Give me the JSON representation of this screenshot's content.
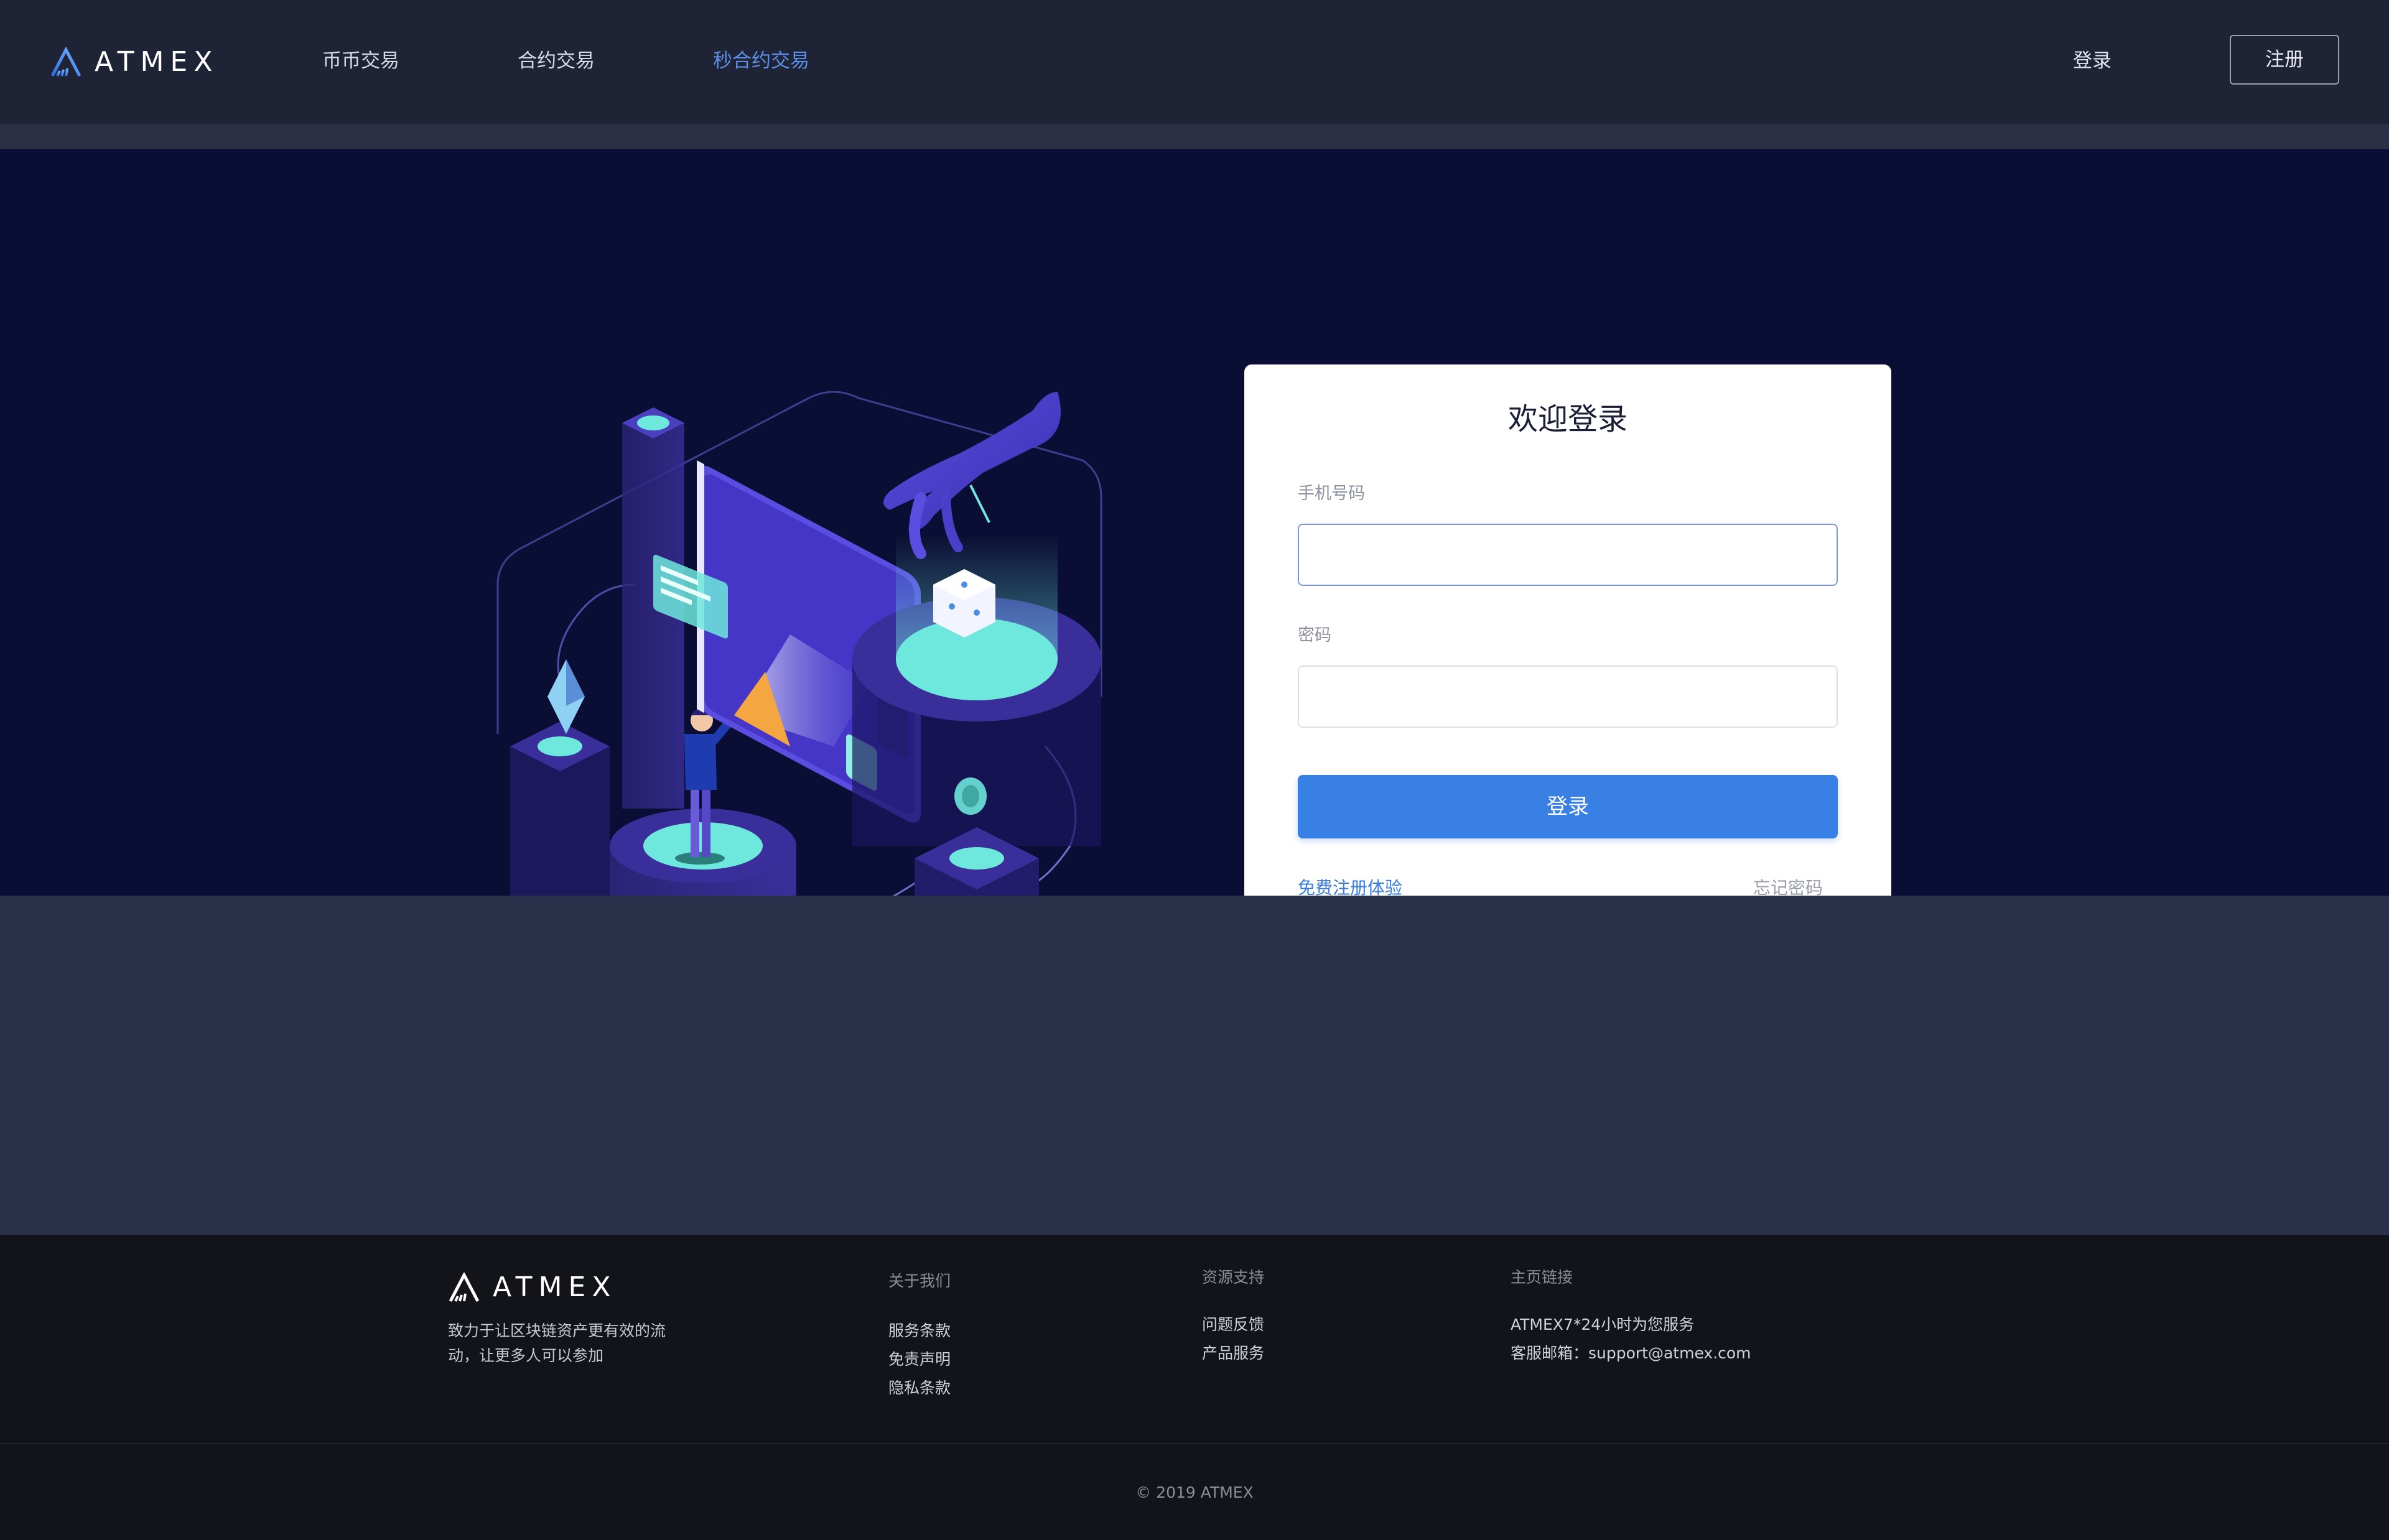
{
  "brand": {
    "name": "ATMEX",
    "accent": "#3880e4",
    "nav_active": "#5c8fe6"
  },
  "nav": {
    "items": [
      {
        "label": "币币交易"
      },
      {
        "label": "合约交易"
      },
      {
        "label": "秒合约交易",
        "active": true
      }
    ],
    "login_label": "登录",
    "register_label": "注册"
  },
  "login": {
    "title": "欢迎登录",
    "phone_label": "手机号码",
    "phone_value": "",
    "password_label": "密码",
    "password_value": "",
    "submit_label": "登录",
    "register_link": "免费注册体验",
    "forgot_link": "忘记密码"
  },
  "footer": {
    "tagline": "致力于让区块链资产更有效的流动，让更多人可以参加",
    "about": {
      "title": "关于我们",
      "links": [
        "服务条款",
        "免责声明",
        "隐私条款"
      ]
    },
    "resources": {
      "title": "资源支持",
      "links": [
        "问题反馈",
        "产品服务"
      ]
    },
    "homepage": {
      "title": "主页链接",
      "lines": [
        "ATMEX7*24小时为您服务",
        "客服邮箱：support@atmex.com"
      ]
    },
    "copyright": "© 2019 ATMEX"
  }
}
